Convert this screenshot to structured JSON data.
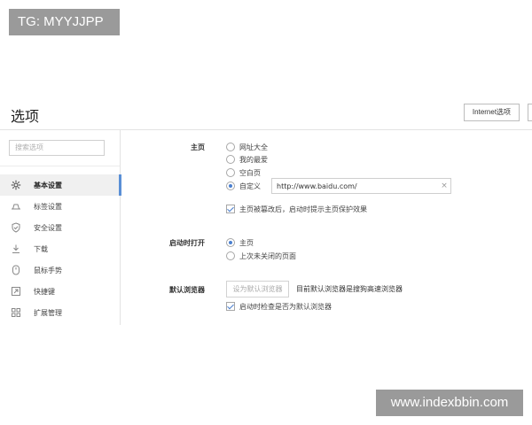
{
  "overlay": {
    "tg_label": "TG: MYYJJPP",
    "watermark": "www.indexbbin.com"
  },
  "header": {
    "title": "选项",
    "internet_button": "Internet选项"
  },
  "sidebar": {
    "search_placeholder": "搜索选项",
    "items": [
      {
        "label": "基本设置",
        "icon": "gear-icon",
        "active": true
      },
      {
        "label": "标签设置",
        "icon": "tab-icon",
        "active": false
      },
      {
        "label": "安全设置",
        "icon": "shield-check-icon",
        "active": false
      },
      {
        "label": "下载",
        "icon": "download-icon",
        "active": false
      },
      {
        "label": "鼠标手势",
        "icon": "mouse-gesture-icon",
        "active": false
      },
      {
        "label": "快捷键",
        "icon": "shortcut-icon",
        "active": false
      },
      {
        "label": "扩展管理",
        "icon": "extensions-icon",
        "active": false
      }
    ]
  },
  "homepage": {
    "label": "主页",
    "options": [
      "网址大全",
      "我的最爱",
      "空白页",
      "自定义"
    ],
    "selected_index": 3,
    "custom_url": "http://www.baidu.com/",
    "clear_symbol": "×",
    "protect_checkbox": {
      "label": "主页被篡改后，启动时提示主页保护效果",
      "checked": true
    }
  },
  "startup": {
    "label": "启动时打开",
    "options": [
      "主页",
      "上次未关闭的页面"
    ],
    "selected_index": 0
  },
  "default_browser": {
    "label": "默认浏览器",
    "button": "设为默认浏览器",
    "status": "目前默认浏览器是搜狗高速浏览器",
    "check_checkbox": {
      "label": "启动时检查是否为默认浏览器",
      "checked": true
    }
  },
  "colors": {
    "accent": "#4a7fcf",
    "active_bar": "#5a8fd6",
    "banner": "#9a9a9a"
  }
}
